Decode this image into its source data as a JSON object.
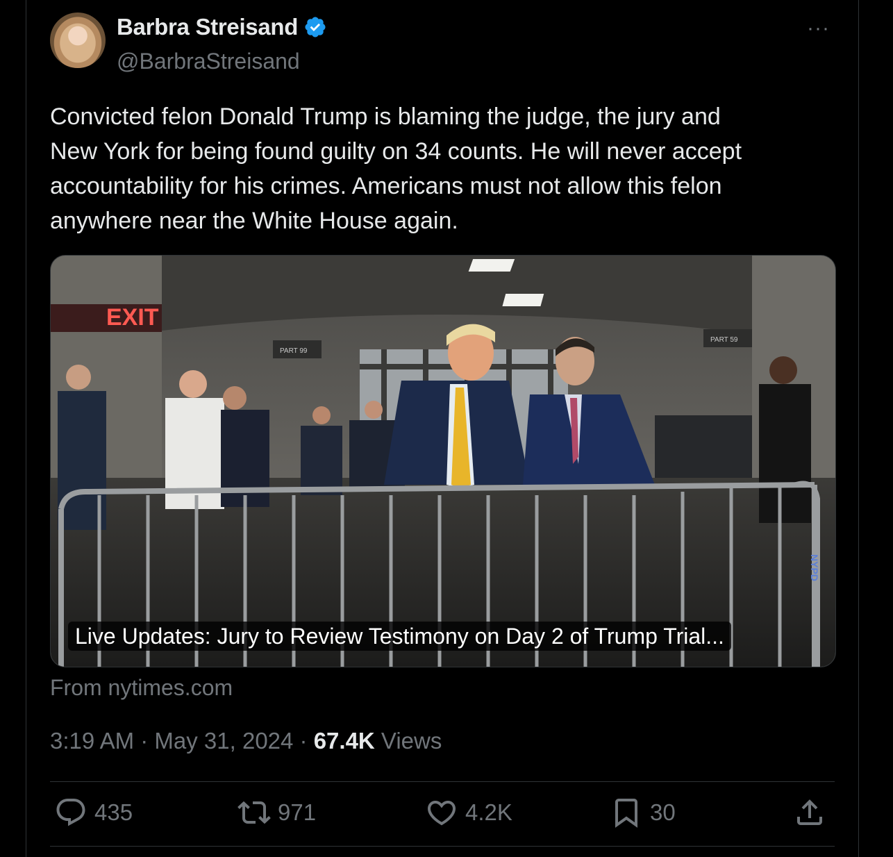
{
  "author": {
    "name": "Barbra Streisand",
    "handle": "@BarbraStreisand",
    "verified_color": "#1d9bf0"
  },
  "more_label": "···",
  "tweet": {
    "text": "Convicted felon Donald Trump is blaming the judge, the jury and\nNew York for being found guilty on 34 counts. He will never accept\naccountability for his crimes. Americans must not allow this felon\nanywhere near the White House again."
  },
  "link_card": {
    "caption": "Live Updates: Jury to Review Testimony on Day 2 of Trump Trial...",
    "source": "From nytimes.com",
    "image_signs": {
      "exit": "EXIT",
      "part_left": "PART 99",
      "part_right": "PART 59",
      "nypd": "NYPD"
    }
  },
  "meta": {
    "time": "3:19 AM",
    "dot1": " · ",
    "date": "May 31, 2024",
    "dot2": " · ",
    "views_count": "67.4K",
    "views_label": " Views"
  },
  "actions": {
    "replies": "435",
    "reposts": "971",
    "likes": "4.2K",
    "bookmarks": "30"
  },
  "icons": [
    "verified-badge-icon",
    "more-icon",
    "reply-icon",
    "repost-icon",
    "like-icon",
    "bookmark-icon",
    "share-icon"
  ]
}
